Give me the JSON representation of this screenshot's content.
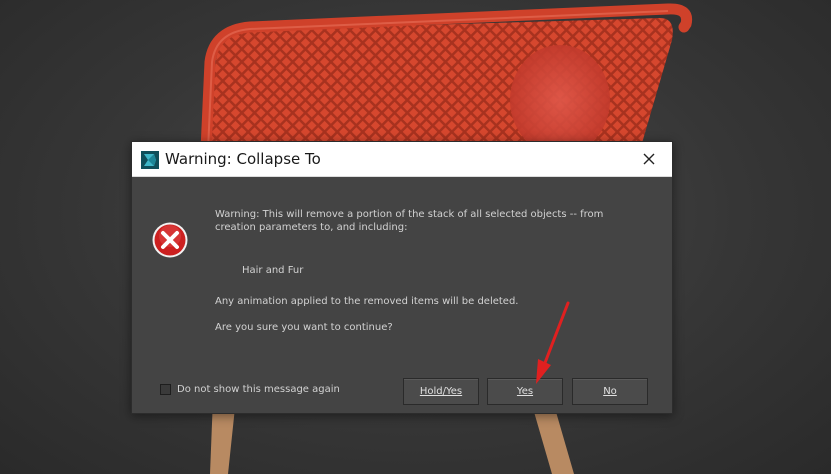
{
  "dialog": {
    "title": "Warning: Collapse To",
    "message_line1": "Warning: This will remove a portion of the stack of all selected objects -- from",
    "message_line2": "creation parameters to, and including:",
    "item_name": "Hair and Fur",
    "animation_note": "Any animation applied to the removed items will be deleted.",
    "confirm_question": "Are you sure you want to continue?",
    "dont_show_label": "Do not show this message again",
    "dont_show_checked": false,
    "buttons": {
      "hold_yes": "Hold/Yes",
      "yes": "Yes",
      "no": "No"
    },
    "close_glyph": "✕",
    "icons": {
      "app": "3ds-max-logo-icon",
      "message": "error-x-icon",
      "close": "close-icon"
    }
  },
  "colors": {
    "chair_frame": "#c9402a",
    "chair_mesh": "#d2452c",
    "chair_legs": "#b88860",
    "dialog_bg": "#444444",
    "error_red": "#cc2020",
    "annotation_arrow": "#e02020"
  }
}
